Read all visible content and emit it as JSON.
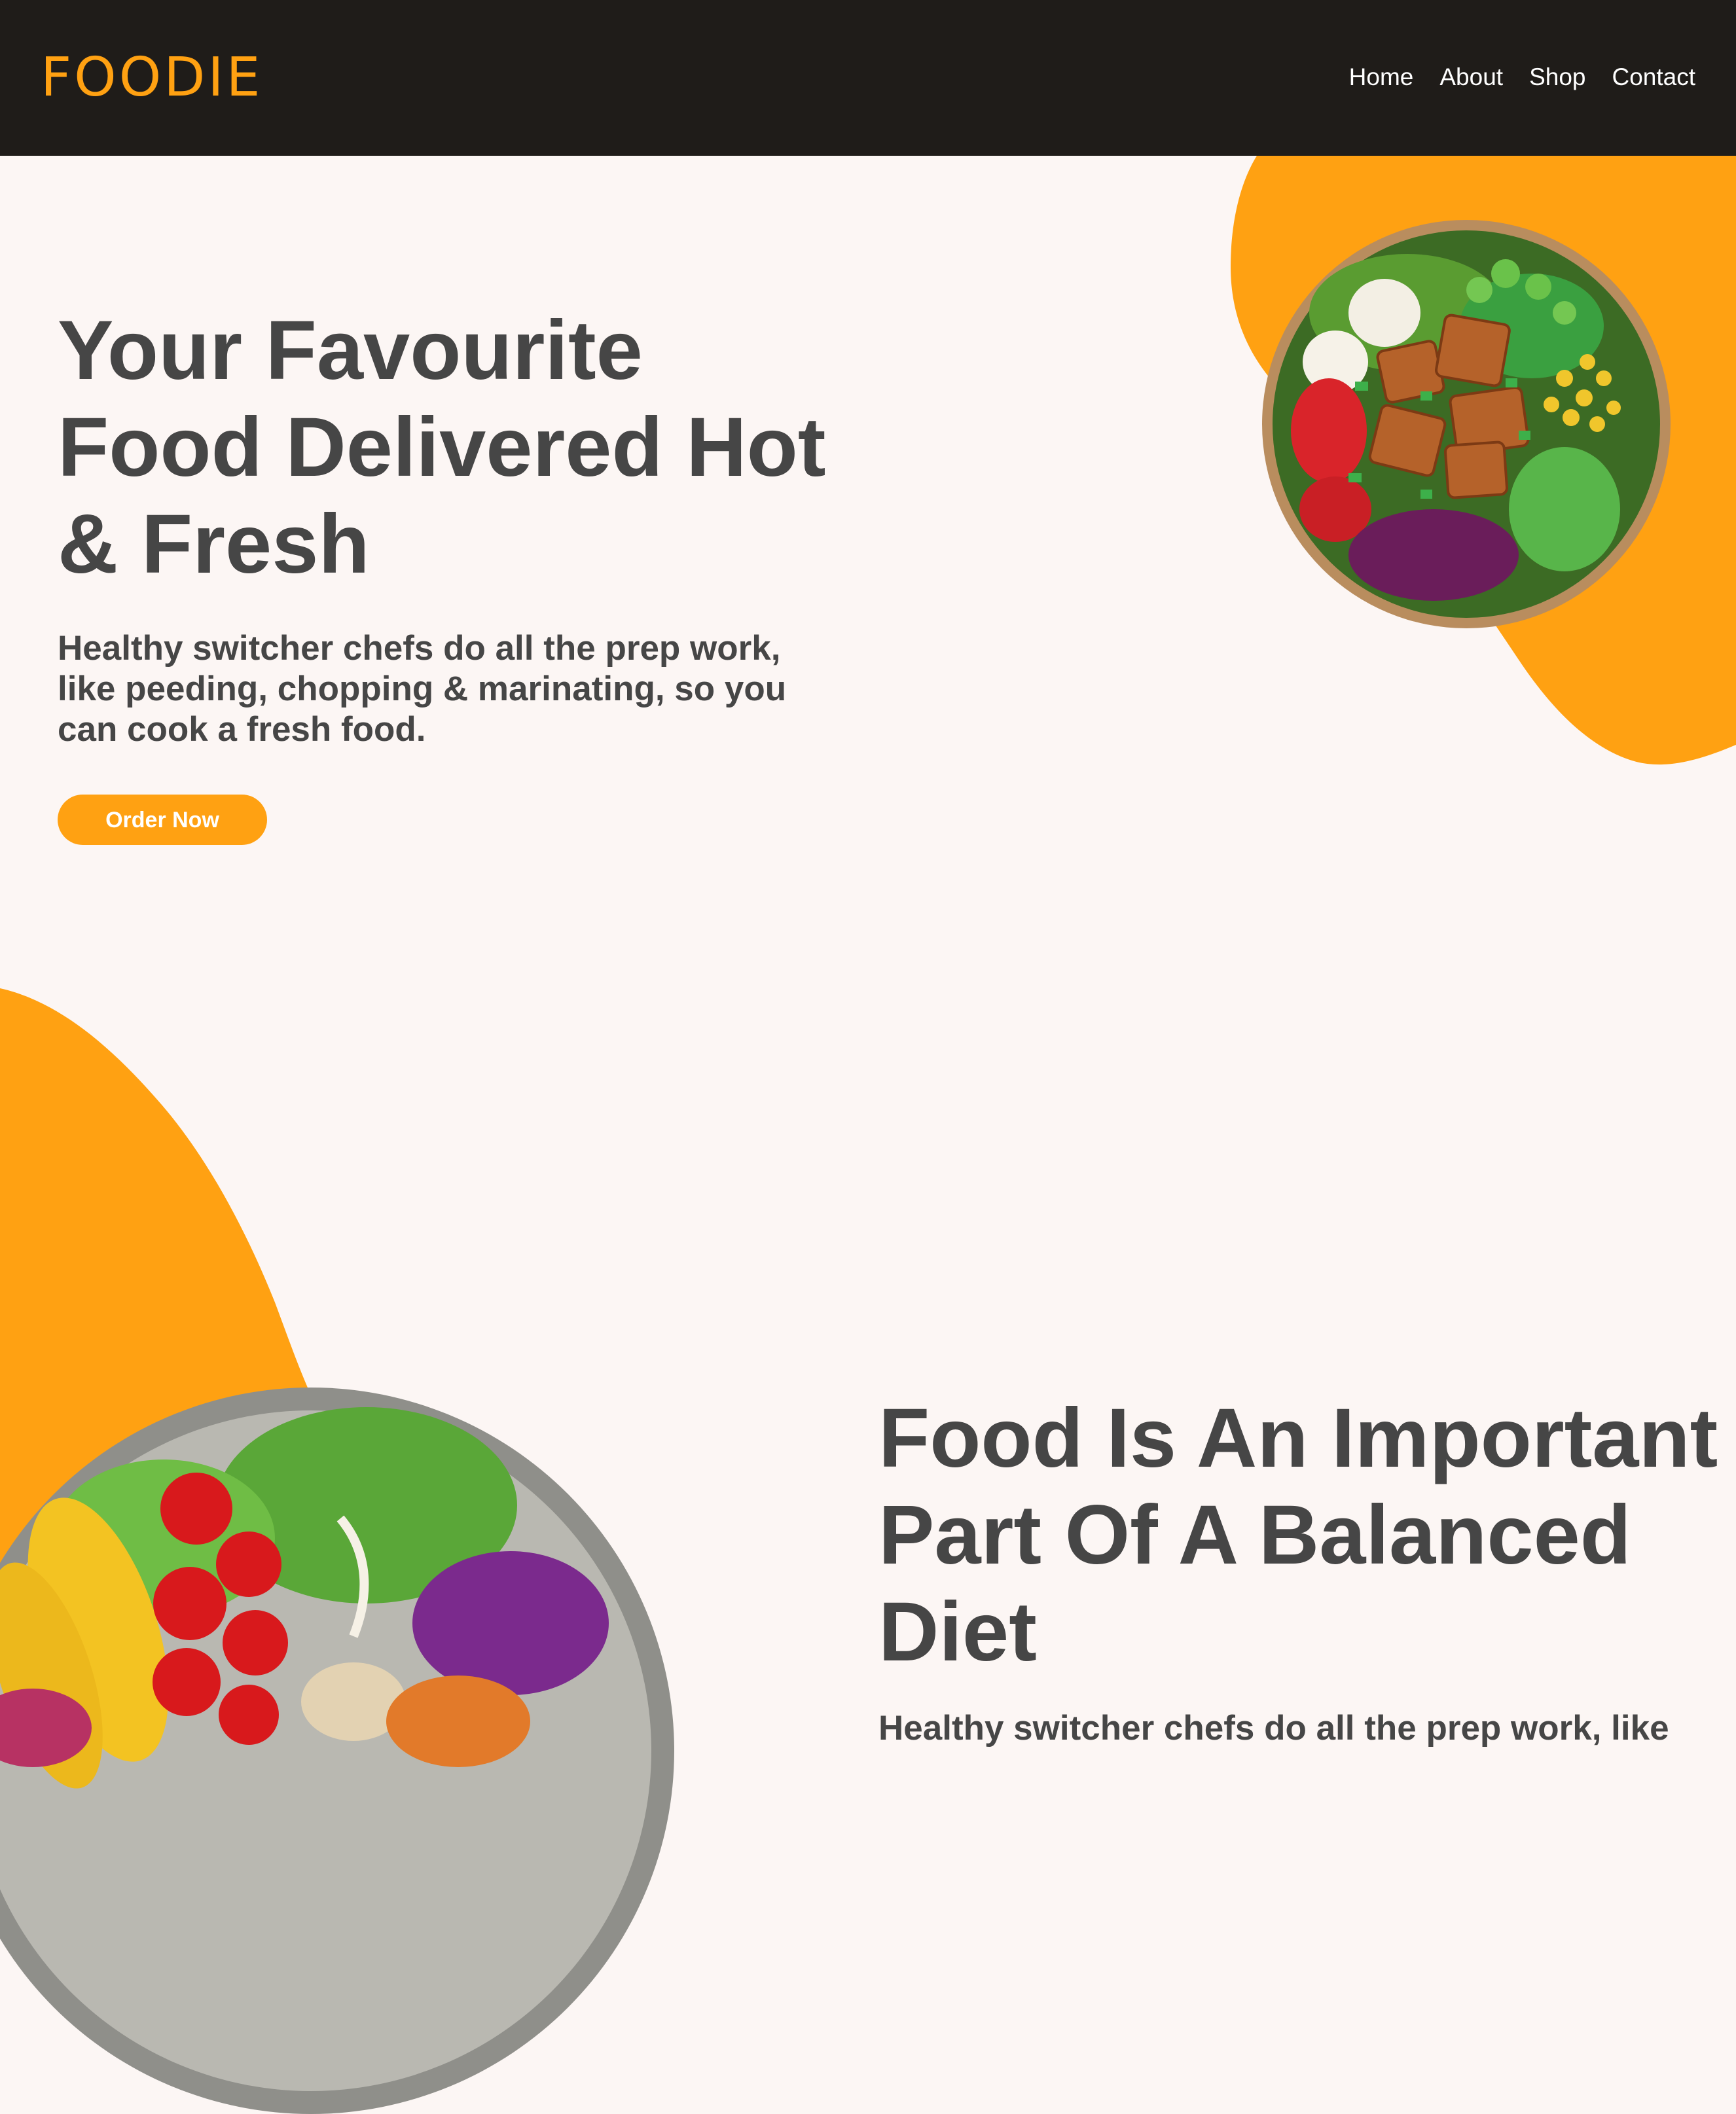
{
  "brand": {
    "logo": "FOODIE",
    "accent_color": "#ffa112",
    "header_color": "#1f1c19",
    "text_color": "#464646"
  },
  "nav": {
    "items": [
      "Home",
      "About",
      "Shop",
      "Contact"
    ]
  },
  "hero": {
    "title_lines": [
      "Your Favourite",
      "Food Delivered Hot",
      "& Fresh"
    ],
    "desc_lines": [
      "Healthy switcher chefs do all the prep work,",
      "like peeding, chopping & marinating, so you",
      "can cook a fresh food."
    ],
    "cta": "Order Now",
    "image": "salad-bowl-top"
  },
  "section2": {
    "title_lines": [
      "Food Is An Important",
      "Part Of A Balanced",
      "Diet"
    ],
    "desc_line": "Healthy switcher chefs do all the prep work, like",
    "image": "salad-bowl-bottom"
  }
}
